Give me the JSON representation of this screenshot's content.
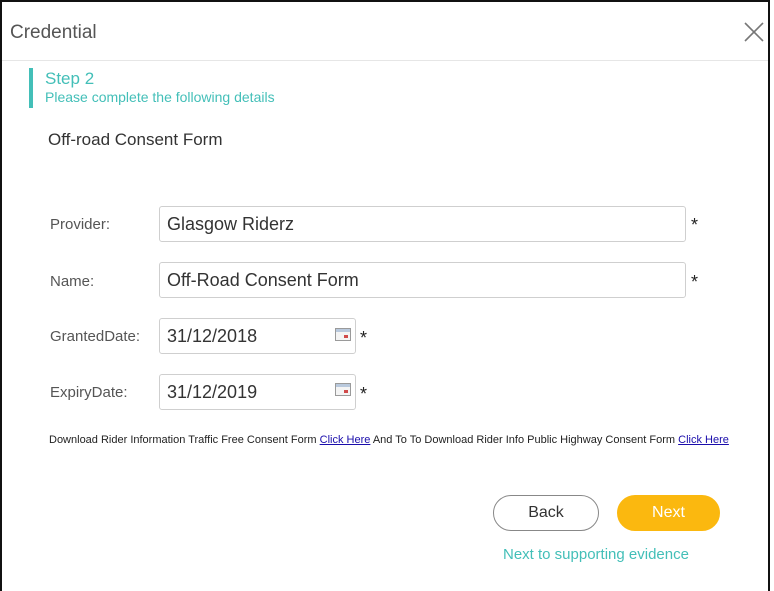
{
  "dialog": {
    "title": "Credential",
    "close_icon": "close-icon"
  },
  "step": {
    "title": "Step 2",
    "subtitle": "Please complete the following details"
  },
  "form": {
    "title": "Off-road Consent Form",
    "provider": {
      "label": "Provider:",
      "value": "Glasgow Riderz"
    },
    "name": {
      "label": "Name:",
      "value": "Off-Road Consent Form"
    },
    "granted_date": {
      "label": "GrantedDate:",
      "value": "31/12/2018"
    },
    "expiry_date": {
      "label": "ExpiryDate:",
      "value": "31/12/2019"
    },
    "required_marker": "*"
  },
  "download": {
    "text_1": "Download Rider Information Traffic Free Consent Form ",
    "link_1": "Click Here",
    "text_2": " And To To Download Rider Info Public Highway Consent Form ",
    "link_2": "Click Here"
  },
  "buttons": {
    "back": "Back",
    "next": "Next",
    "next_hint": "Next to supporting evidence"
  },
  "colors": {
    "accent": "#43bfb8",
    "next_button": "#fbb80f",
    "link": "#1a0dab"
  }
}
